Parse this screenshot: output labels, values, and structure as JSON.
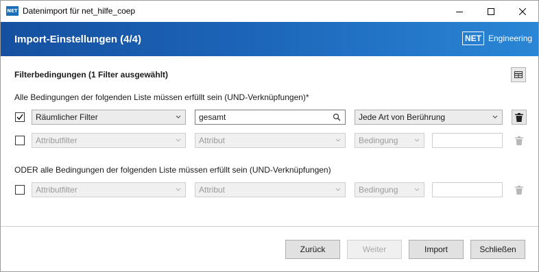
{
  "window": {
    "title": "Datenimport für net_hilfe_coep",
    "app_icon_text": "NET"
  },
  "banner": {
    "title": "Import-Einstellungen (4/4)",
    "logo_box": "NET",
    "logo_text": "Engineering"
  },
  "filters": {
    "section_title": "Filterbedingungen (1 Filter ausgewählt)",
    "and_caption": "Alle Bedingungen der folgenden Liste müssen erfüllt sein (UND-Verknüpfungen)*",
    "or_caption": "ODER alle Bedingungen der folgenden Liste müssen erfüllt sein (UND-Verknüpfungen)",
    "row1": {
      "checked": true,
      "type": "Räumlicher Filter",
      "search_value": "gesamt",
      "condition": "Jede Art von Berührung"
    },
    "row2": {
      "checked": false,
      "type": "Attributfilter",
      "attribute": "Attribut",
      "condition": "Bedingung",
      "value": ""
    },
    "row3": {
      "checked": false,
      "type": "Attributfilter",
      "attribute": "Attribut",
      "condition": "Bedingung",
      "value": ""
    }
  },
  "buttons": {
    "back": "Zurück",
    "next": "Weiter",
    "import": "Import",
    "close": "Schließen"
  },
  "colors": {
    "banner_start": "#1650a0",
    "banner_end": "#2a86d6",
    "accent": "#1c6fb6"
  }
}
